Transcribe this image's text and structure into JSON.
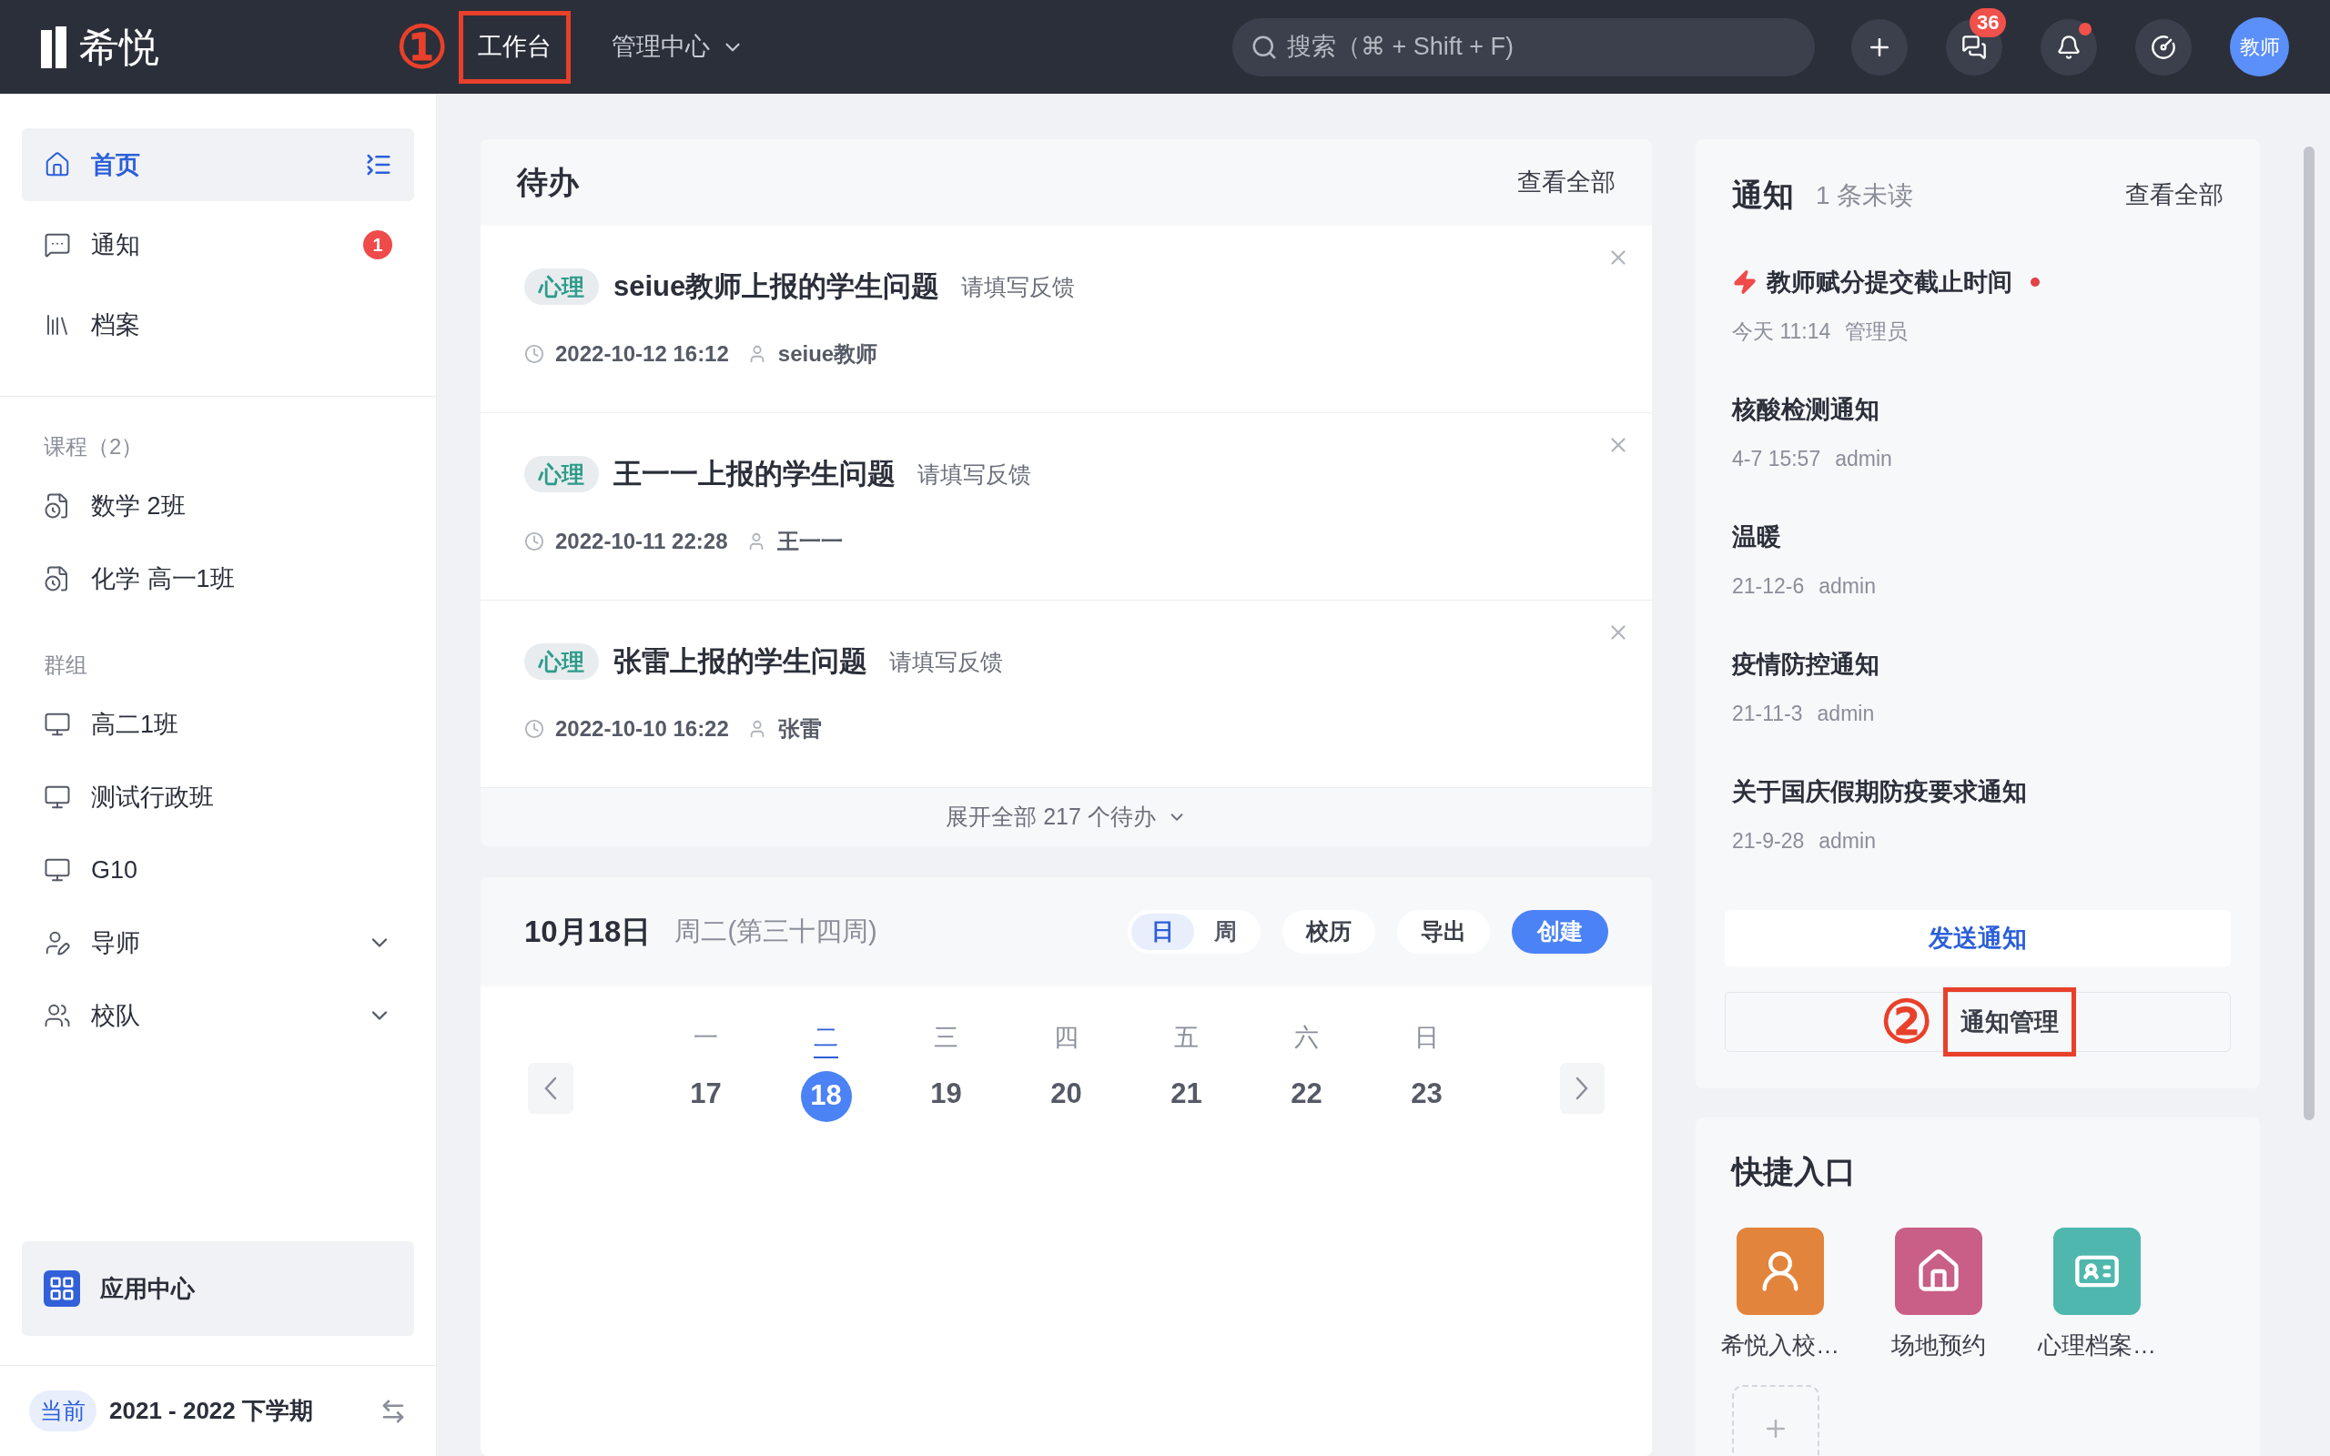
{
  "topbar": {
    "logo": "希悦",
    "nav": [
      {
        "label": "工作台",
        "kind": "link",
        "selected": true,
        "highlighted": true,
        "annotation": "①"
      },
      {
        "label": "管理中心",
        "kind": "dropdown",
        "selected": false,
        "highlighted": false
      }
    ],
    "search": {
      "placeholder": "搜索（⌘ + Shift + F)"
    },
    "message_badge": "36",
    "bell_unread": true,
    "avatar": "教师"
  },
  "sidebar": {
    "main_items": [
      {
        "label": "首页",
        "kind": "home",
        "selected": true
      },
      {
        "label": "通知",
        "kind": "notice",
        "selected": false,
        "badge": "1"
      },
      {
        "label": "档案",
        "kind": "archive",
        "selected": false
      }
    ],
    "sections": [
      {
        "title": "课程（2）",
        "items": [
          {
            "label": "数学 2班",
            "kind": "course"
          },
          {
            "label": "化学 高一1班",
            "kind": "course"
          }
        ]
      },
      {
        "title": "群组",
        "items": [
          {
            "label": "高二1班",
            "kind": "group"
          },
          {
            "label": "测试行政班",
            "kind": "group"
          },
          {
            "label": "G10",
            "kind": "group"
          },
          {
            "label": "导师",
            "kind": "mentor",
            "expanded": false
          },
          {
            "label": "校队",
            "kind": "team",
            "expanded": false
          }
        ]
      }
    ],
    "app_center": "应用中心",
    "term": {
      "tag": "当前",
      "label": "2021 - 2022 下学期"
    }
  },
  "todo": {
    "title": "待办",
    "view_all": "查看全部",
    "items": [
      {
        "tag": "心理",
        "title": "seiue教师上报的学生问题",
        "hint": "请填写反馈",
        "time": "2022-10-12 16:12",
        "author": "seiue教师"
      },
      {
        "tag": "心理",
        "title": "王一一上报的学生问题",
        "hint": "请填写反馈",
        "time": "2022-10-11 22:28",
        "author": "王一一"
      },
      {
        "tag": "心理",
        "title": "张雷上报的学生问题",
        "hint": "请填写反馈",
        "time": "2022-10-10 16:22",
        "author": "张雷"
      }
    ],
    "expand": "展开全部 217 个待办"
  },
  "calendar": {
    "date": "10月18日",
    "weekday": "周二(第三十四周)",
    "views": [
      {
        "label": "日",
        "selected": true
      },
      {
        "label": "周",
        "selected": false
      }
    ],
    "buttons": [
      "校历",
      "导出"
    ],
    "create": "创建",
    "days": [
      {
        "weekday": "一",
        "date": "17",
        "selected": false
      },
      {
        "weekday": "二",
        "date": "18",
        "selected": true
      },
      {
        "weekday": "三",
        "date": "19",
        "selected": false
      },
      {
        "weekday": "四",
        "date": "20",
        "selected": false
      },
      {
        "weekday": "五",
        "date": "21",
        "selected": false
      },
      {
        "weekday": "六",
        "date": "22",
        "selected": false
      },
      {
        "weekday": "日",
        "date": "23",
        "selected": false
      }
    ]
  },
  "notices": {
    "title": "通知",
    "unread": "1 条未读",
    "view_all": "查看全部",
    "items": [
      {
        "title": "教师赋分提交截止时间",
        "time": "今天 11:14",
        "author": "管理员",
        "urgent": true,
        "unread": true
      },
      {
        "title": "核酸检测通知",
        "time": "4-7 15:57",
        "author": "admin",
        "urgent": false,
        "unread": false
      },
      {
        "title": "温暖",
        "time": "21-12-6",
        "author": "admin",
        "urgent": false,
        "unread": false
      },
      {
        "title": "疫情防控通知",
        "time": "21-11-3",
        "author": "admin",
        "urgent": false,
        "unread": false
      },
      {
        "title": "关于国庆假期防疫要求通知",
        "time": "21-9-28",
        "author": "admin",
        "urgent": false,
        "unread": false
      }
    ],
    "send": "发送通知",
    "manage": {
      "label": "通知管理",
      "highlighted": true,
      "annotation": "②"
    }
  },
  "quick": {
    "title": "快捷入口",
    "items": [
      {
        "label": "希悦入校…",
        "kind": "visitor",
        "color": "#e3843c"
      },
      {
        "label": "场地预约",
        "kind": "venue",
        "color": "#c95f86"
      },
      {
        "label": "心理档案…",
        "kind": "record",
        "color": "#4fb7ad"
      }
    ]
  }
}
